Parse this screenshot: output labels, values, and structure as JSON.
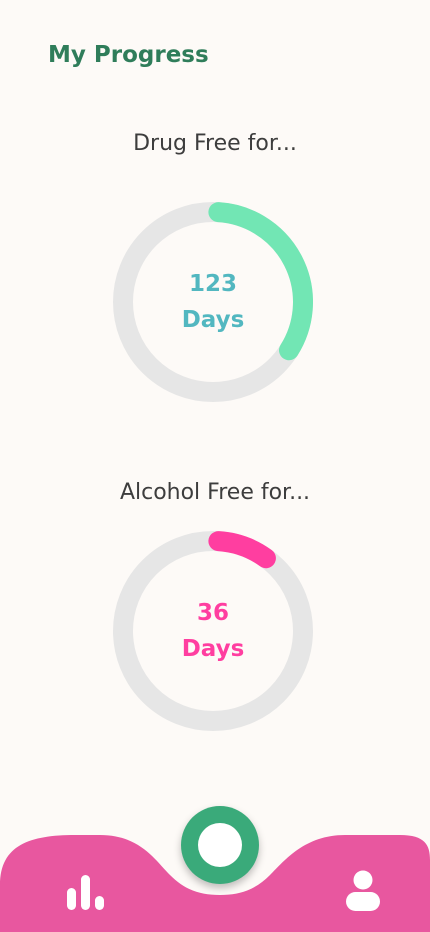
{
  "header": {
    "title": "My Progress"
  },
  "drug": {
    "title": "Drug Free for...",
    "count": "123",
    "unit": "Days",
    "progress": 0.34,
    "color": "#72e6b4",
    "text_color": "#52b7c0"
  },
  "alcohol": {
    "title": "Alcohol Free for...",
    "count": "36",
    "unit": "Days",
    "progress": 0.1,
    "color": "#ff3ea0",
    "text_color": "#ff3ea0"
  },
  "nav": {
    "bar_color": "#e8579f",
    "fab_color": "#3aaa7a",
    "left_icon": "bar-chart-icon",
    "center_icon": "ring-icon",
    "right_icon": "user-icon"
  },
  "colors": {
    "track": "#e6e6e6",
    "title": "#2f7d5a",
    "background": "#fdfaf7"
  }
}
